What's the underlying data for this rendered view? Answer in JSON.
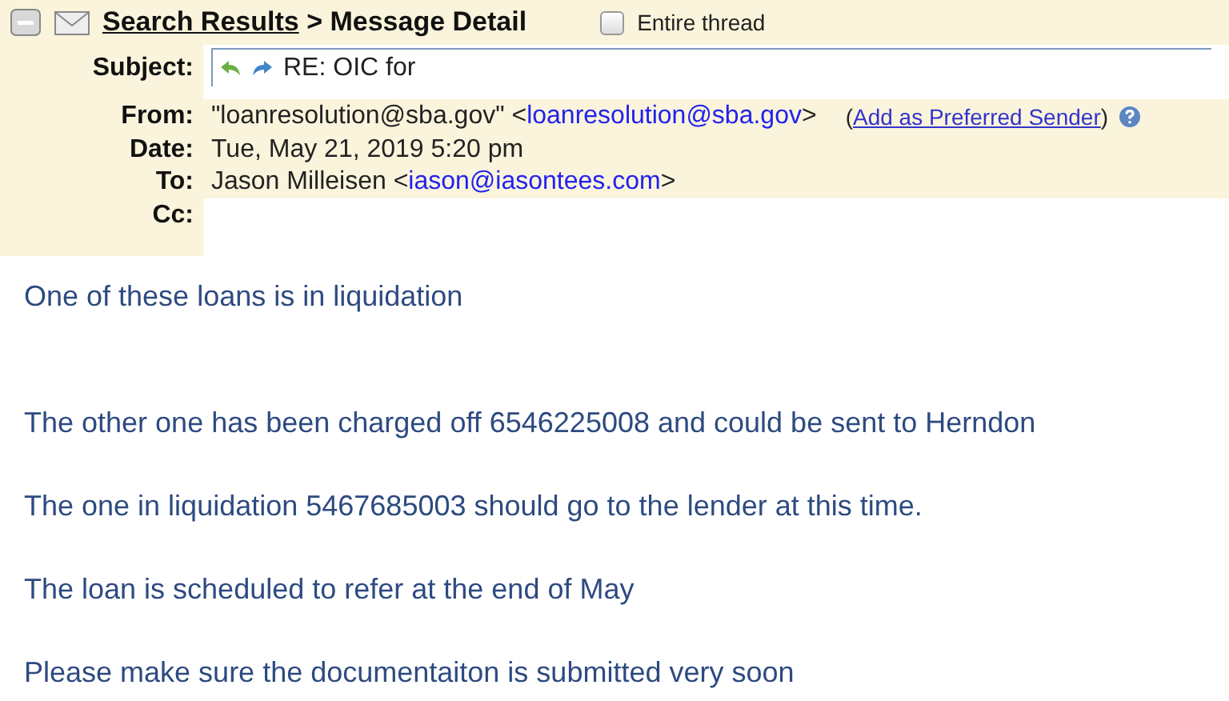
{
  "header": {
    "breadcrumb_link": "Search Results",
    "breadcrumb_rest": " > Message Detail",
    "entire_thread": {
      "label": "Entire thread",
      "checked": false
    }
  },
  "fields": [
    {
      "kind": "subject",
      "label": "Subject:",
      "value": "RE: OIC for"
    },
    {
      "kind": "from",
      "label": "From:",
      "value": "\"loanresolution@sba.gov\" <",
      "link": "loanresolution@sba.gov",
      "after": ">",
      "action_open": "(",
      "action": "Add as Preferred Sender",
      "action_close": ")"
    },
    {
      "kind": "plain",
      "label": "Date:",
      "value": "Tue, May 21, 2019 5:20 pm"
    },
    {
      "kind": "to",
      "label": "To:",
      "value": "Jason Milleisen <",
      "link": "iason@iasontees.com",
      "after": ">"
    },
    {
      "kind": "empty",
      "label": "Cc:"
    }
  ],
  "body": [
    "One of these loans is in liquidation",
    "The other one has been charged off 6546225008 and could be sent to Herndon",
    "The one in liquidation 5467685003 should go to the lender at this time.",
    "The loan is scheduled to refer at the end of May",
    "Please make sure the documentaiton is submitted very soon"
  ]
}
